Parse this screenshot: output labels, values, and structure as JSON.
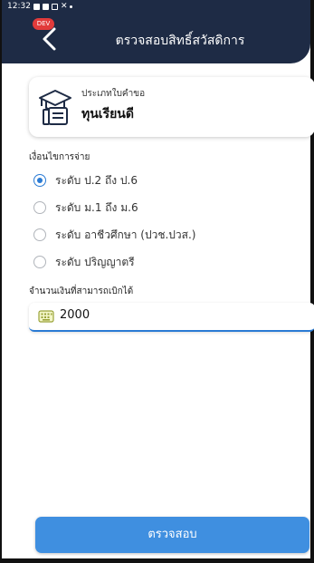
{
  "statusbar": {
    "time": "12:32"
  },
  "header": {
    "badge": "DEV",
    "title": "ตรวจสอบสิทธิ์สวัสดิการ"
  },
  "request_type": {
    "label": "ประเภทใบคำขอ",
    "value": "ทุนเรียนดี"
  },
  "conditions": {
    "label": "เงื่อนไขการจ่าย",
    "options": [
      {
        "label": "ระดับ ป.2 ถึง ป.6",
        "selected": true
      },
      {
        "label": "ระดับ ม.1 ถึง ม.6",
        "selected": false
      },
      {
        "label": "ระดับ อาชีวศึกษา (ปวช.ปวส.)",
        "selected": false
      },
      {
        "label": "ระดับ ปริญญาตรี",
        "selected": false
      }
    ]
  },
  "amount": {
    "label": "จำนวนเงินที่สามารถเบิกได้",
    "value": "2000"
  },
  "submit": {
    "label": "ตรวจสอบ"
  },
  "colors": {
    "header_bg": "#1e2b45",
    "accent": "#2a7bd4",
    "button": "#3f8fe0",
    "badge": "#e23b3b"
  }
}
